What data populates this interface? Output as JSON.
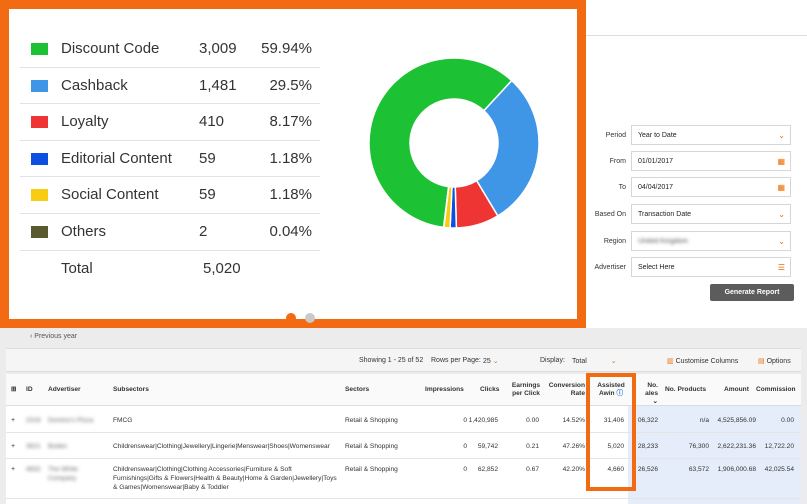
{
  "colors": {
    "accent": "#f26a11",
    "discount": "#1dc234",
    "cashback": "#3f95e6",
    "loyalty": "#ee3533",
    "editorial": "#0d4fe0",
    "social": "#f7cc12",
    "others": "#5a5a30"
  },
  "legend": {
    "items": [
      {
        "label": "Discount Code",
        "count": "3,009",
        "pct": "59.94%",
        "color": "#1dc234",
        "value": 3009
      },
      {
        "label": "Cashback",
        "count": "1,481",
        "pct": "29.5%",
        "color": "#3f95e6",
        "value": 1481
      },
      {
        "label": "Loyalty",
        "count": "410",
        "pct": "8.17%",
        "color": "#ee3533",
        "value": 410
      },
      {
        "label": "Editorial Content",
        "count": "59",
        "pct": "1.18%",
        "color": "#0d4fe0",
        "value": 59
      },
      {
        "label": "Social Content",
        "count": "59",
        "pct": "1.18%",
        "color": "#f7cc12",
        "value": 59
      },
      {
        "label": "Others",
        "count": "2",
        "pct": "0.04%",
        "color": "#5a5a30",
        "value": 2
      }
    ],
    "total_label": "Total",
    "total_count": "5,020"
  },
  "filters": {
    "period_label": "Period",
    "period_value": "Year to Date",
    "from_label": "From",
    "from_value": "01/01/2017",
    "to_label": "To",
    "to_value": "04/04/2017",
    "based_label": "Based On",
    "based_value": "Transaction Date",
    "region_label": "Region",
    "region_value": "United Kingdom",
    "advertiser_label": "Advertiser",
    "advertiser_value": "Select Here",
    "generate_label": "Generate Report"
  },
  "nav": {
    "previous": "‹ Previous year"
  },
  "toolbar": {
    "showing": "Showing 1 - 25 of 52",
    "rows_label": "Rows per Page:",
    "rows_value": "25",
    "display_label": "Display:",
    "display_value": "Total",
    "customise": "Customise Columns",
    "options": "Options"
  },
  "table": {
    "headers": {
      "id": "ID",
      "advertiser": "Advertiser",
      "subsectors": "Subsectors",
      "sectors": "Sectors",
      "impressions": "Impressions",
      "clicks": "Clicks",
      "epc_1": "Earnings",
      "epc_2": "per Click",
      "conv_1": "Conversion",
      "conv_2": "Rate",
      "assist_1": "Assisted",
      "assist_2": "Awin",
      "sales_1": "No.",
      "sales_2": "ales",
      "products": "No. Products",
      "amount": "Amount",
      "commission": "Commission"
    },
    "rows": [
      {
        "id": "2316",
        "advertiser": "Domino's Pizza",
        "subsectors": "FMCG",
        "sector": "Retail & Shopping",
        "impressions": "0",
        "clicks": "1,420,985",
        "epc": "0.00",
        "conv": "14.52%",
        "assist": "31,406",
        "sales": "06,322",
        "products": "n/a",
        "amount": "4,525,856.09",
        "commission": "0.00"
      },
      {
        "id": "3621",
        "advertiser": "Boden",
        "subsectors": "Childrenswear|Clothing|Jewellery|Lingerie|Menswear|Shoes|Womenswear",
        "sector": "Retail & Shopping",
        "impressions": "0",
        "clicks": "59,742",
        "epc": "0.21",
        "conv": "47.26%",
        "assist": "5,020",
        "sales": "28,233",
        "products": "76,300",
        "amount": "2,622,231.36",
        "commission": "12,722.20"
      },
      {
        "id": "4832",
        "advertiser": "The White Company",
        "subsectors": "Childrenswear|Clothing|Clothing Accessories|Furniture & Soft Furnishings|Gifts & Flowers|Health & Beauty|Home & Garden|Jewellery|Toys & Games|Womenswear|Baby & Toddler",
        "sector": "Retail & Shopping",
        "impressions": "0",
        "clicks": "62,852",
        "epc": "0.67",
        "conv": "42.20%",
        "assist": "4,660",
        "sales": "26,526",
        "products": "63,572",
        "amount": "1,906,000.68",
        "commission": "42,025.54"
      }
    ]
  }
}
